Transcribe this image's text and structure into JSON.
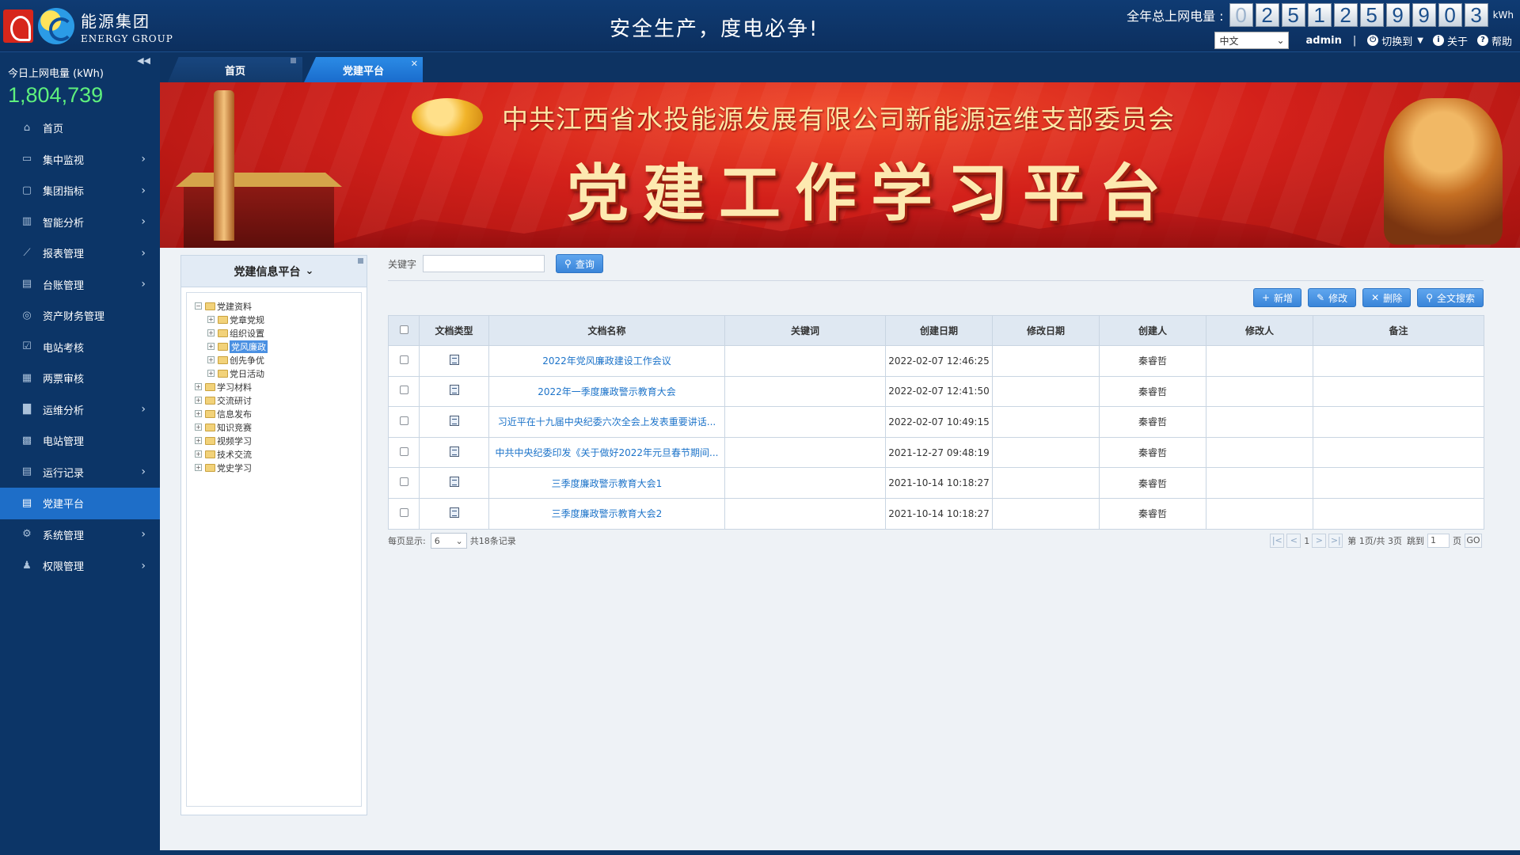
{
  "header": {
    "company_cn": "能源集团",
    "company_en": "ENERGY GROUP",
    "slogan": "安全生产，度电必争!",
    "total_power_label": "全年总上网电量 :",
    "total_power_digits": [
      "0",
      "2",
      "5",
      "1",
      "2",
      "5",
      "9",
      "9",
      "0",
      "3"
    ],
    "total_power_unit": "kWh",
    "language": "中文",
    "user": "admin",
    "separator": "|",
    "switch_label": "切换到",
    "about_label": "关于",
    "help_label": "帮助"
  },
  "sidebar": {
    "today_label": "今日上网电量 (kWh)",
    "today_value": "1,804,739",
    "items": [
      {
        "label": "首页",
        "icon": "home-icon",
        "has_arrow": false
      },
      {
        "label": "集中监视",
        "icon": "monitor-icon",
        "has_arrow": true
      },
      {
        "label": "集团指标",
        "icon": "screen-icon",
        "has_arrow": true
      },
      {
        "label": "智能分析",
        "icon": "bar-chart-icon",
        "has_arrow": true
      },
      {
        "label": "报表管理",
        "icon": "line-chart-icon",
        "has_arrow": true
      },
      {
        "label": "台账管理",
        "icon": "ledger-icon",
        "has_arrow": true
      },
      {
        "label": "资产财务管理",
        "icon": "asset-icon",
        "has_arrow": false
      },
      {
        "label": "电站考核",
        "icon": "check-icon",
        "has_arrow": false
      },
      {
        "label": "两票审核",
        "icon": "ticket-icon",
        "has_arrow": false
      },
      {
        "label": "运维分析",
        "icon": "analysis-icon",
        "has_arrow": true
      },
      {
        "label": "电站管理",
        "icon": "station-icon",
        "has_arrow": false
      },
      {
        "label": "运行记录",
        "icon": "record-icon",
        "has_arrow": true
      },
      {
        "label": "党建平台",
        "icon": "doc-icon",
        "has_arrow": false,
        "active": true
      },
      {
        "label": "系统管理",
        "icon": "gear-icon",
        "has_arrow": true
      },
      {
        "label": "权限管理",
        "icon": "users-icon",
        "has_arrow": true
      }
    ]
  },
  "tabs": {
    "home": "首页",
    "current": "党建平台"
  },
  "banner": {
    "org": "中共江西省水投能源发展有限公司新能源运维支部委员会",
    "title": "党建工作学习平台"
  },
  "tree": {
    "header": "党建信息平台",
    "root": "党建资料",
    "children": [
      "党章党规",
      "组织设置",
      "党风廉政",
      "创先争优",
      "党日活动"
    ],
    "selected": "党风廉政",
    "others": [
      "学习材料",
      "交流研讨",
      "信息发布",
      "知识竞赛",
      "视频学习",
      "技术交流",
      "党史学习"
    ]
  },
  "search": {
    "keyword_label": "关键字",
    "keyword_value": "",
    "query_button": "查询"
  },
  "toolbar": {
    "add": "新增",
    "edit": "修改",
    "delete": "删除",
    "fulltext": "全文搜索"
  },
  "table": {
    "columns": [
      "文档类型",
      "文档名称",
      "关键词",
      "创建日期",
      "修改日期",
      "创建人",
      "修改人",
      "备注"
    ],
    "rows": [
      {
        "name": "2022年党风廉政建设工作会议",
        "keyword": "",
        "created": "2022-02-07 12:46:25",
        "modified": "",
        "creator": "秦睿哲",
        "modifier": "",
        "remark": "",
        "icon": "doc-file-icon"
      },
      {
        "name": "2022年一季度廉政警示教育大会",
        "keyword": "",
        "created": "2022-02-07 12:41:50",
        "modified": "",
        "creator": "秦睿哲",
        "modifier": "",
        "remark": "",
        "icon": "doc-file-icon"
      },
      {
        "name": "习近平在十九届中央纪委六次全会上发表重要讲话...",
        "keyword": "",
        "created": "2022-02-07 10:49:15",
        "modified": "",
        "creator": "秦睿哲",
        "modifier": "",
        "remark": "",
        "icon": "word-file-icon"
      },
      {
        "name": "中共中央纪委印发《关于做好2022年元旦春节期间...",
        "keyword": "",
        "created": "2021-12-27 09:48:19",
        "modified": "",
        "creator": "秦睿哲",
        "modifier": "",
        "remark": "",
        "icon": "word-file-icon"
      },
      {
        "name": "三季度廉政警示教育大会1",
        "keyword": "",
        "created": "2021-10-14 10:18:27",
        "modified": "",
        "creator": "秦睿哲",
        "modifier": "",
        "remark": "",
        "icon": "doc-file-icon"
      },
      {
        "name": "三季度廉政警示教育大会2",
        "keyword": "",
        "created": "2021-10-14 10:18:27",
        "modified": "",
        "creator": "秦睿哲",
        "modifier": "",
        "remark": "",
        "icon": "doc-file-icon"
      }
    ]
  },
  "pager": {
    "per_page_label": "每页显示:",
    "per_page": "6",
    "total_text": "共18条记录",
    "current_page": "1",
    "page_info": "第 1页/共 3页",
    "jump_label": "跳到",
    "jump_value": "1",
    "page_suffix": "页",
    "go_label": "GO"
  }
}
